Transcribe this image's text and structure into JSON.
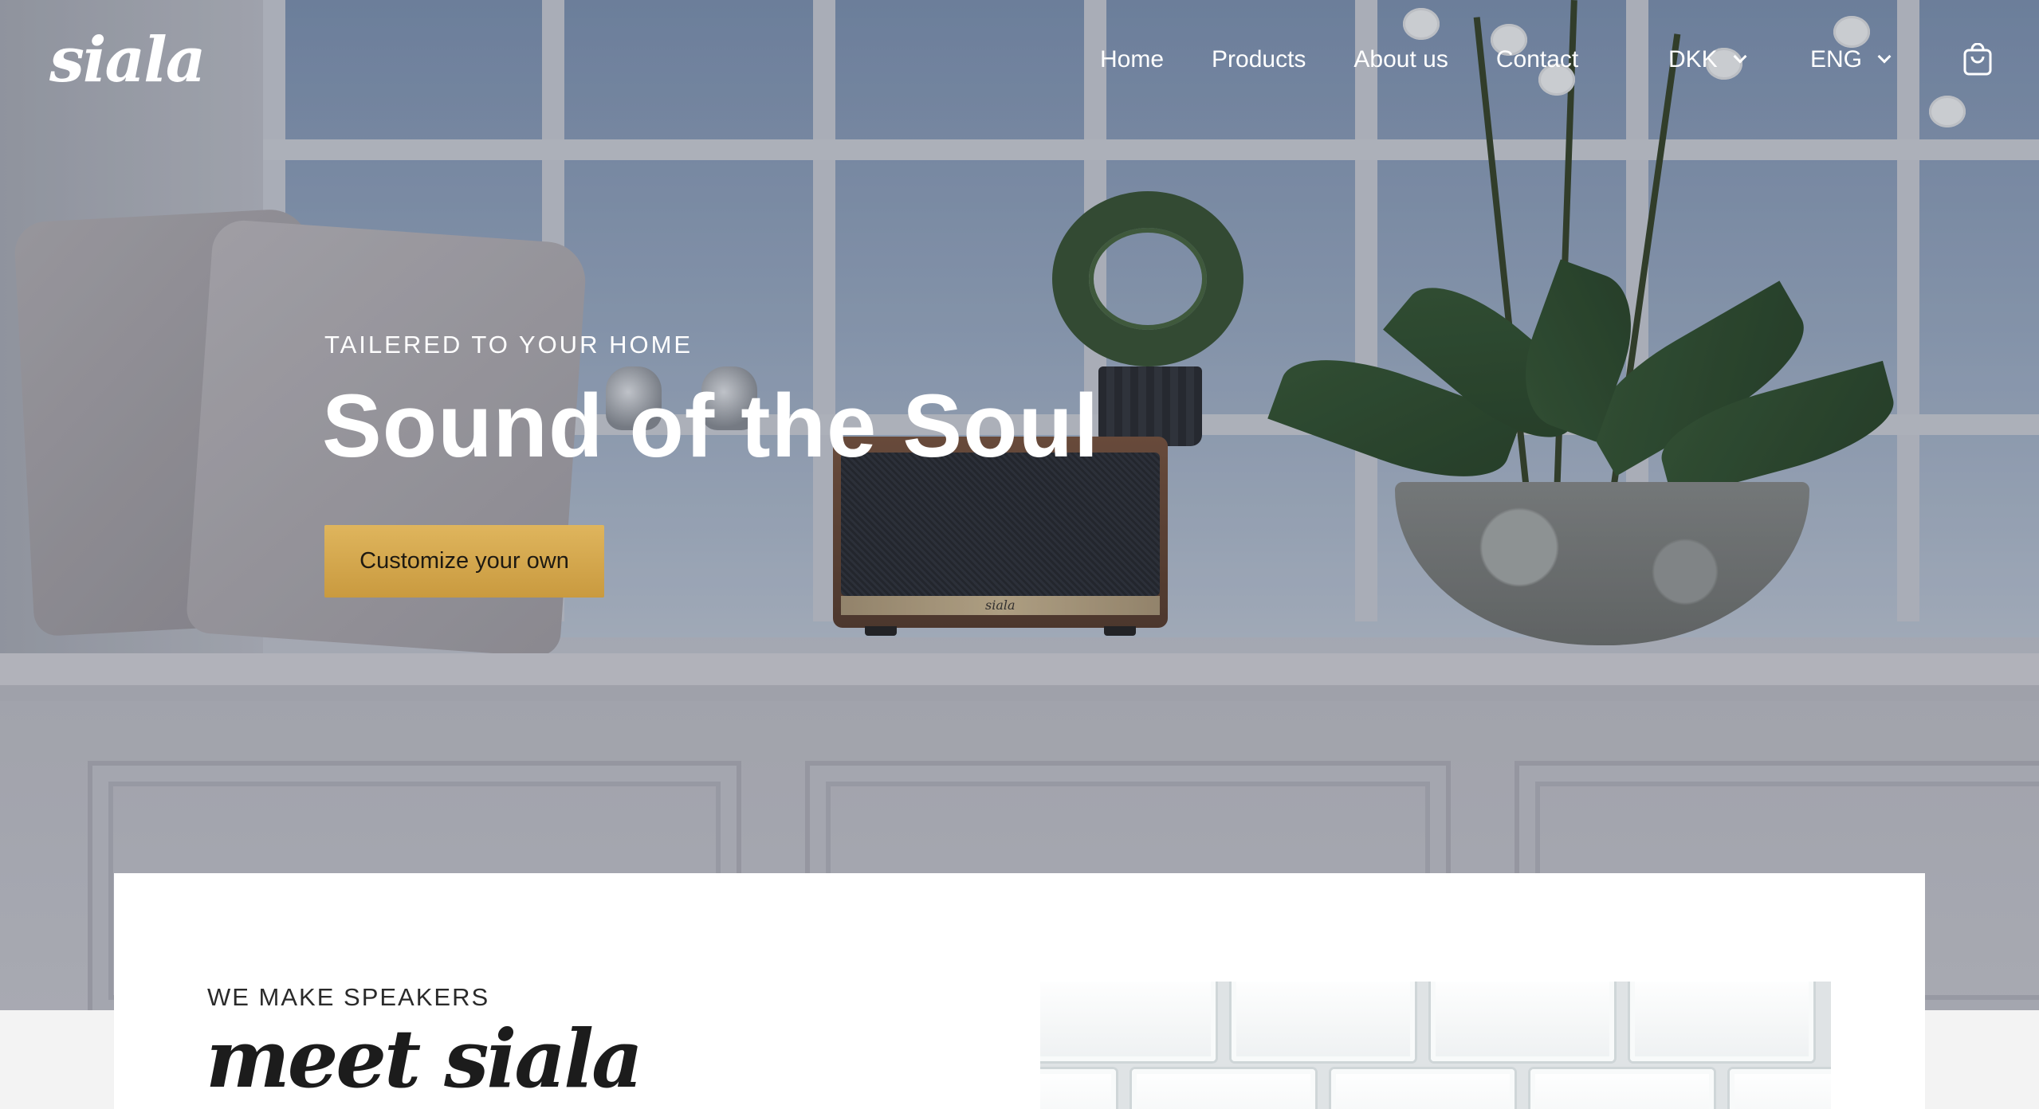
{
  "brand": {
    "logo_text": "siala"
  },
  "nav": {
    "links": [
      "Home",
      "Products",
      "About us",
      "Contact"
    ],
    "currency": "DKK",
    "language": "ENG",
    "cart_icon": "shopping-bag-icon"
  },
  "hero": {
    "eyebrow": "TAILERED TO YOUR HOME",
    "headline": "Sound of the Soul",
    "cta_label": "Customize your own",
    "speaker_badge": "siala"
  },
  "intro": {
    "eyebrow": "WE MAKE SPEAKERS",
    "title": "meet siala"
  },
  "colors": {
    "cta_gold": "#d4a84e",
    "text_light": "#ffffff",
    "text_dark": "#1c1c1c"
  }
}
